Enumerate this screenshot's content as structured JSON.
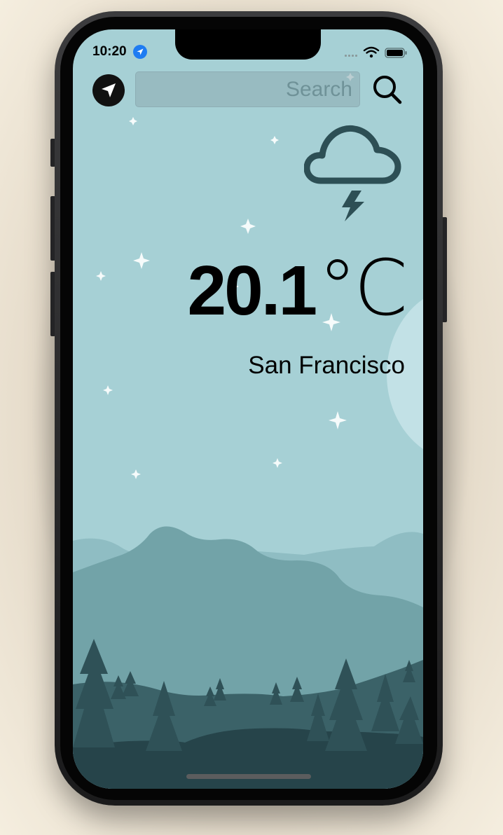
{
  "status_bar": {
    "time": "10:20",
    "location_icon": "location-arrow-icon",
    "signal_icon": "cellular-signal-icon",
    "wifi_icon": "wifi-icon",
    "battery_icon": "battery-icon"
  },
  "search": {
    "placeholder": "Search",
    "value": "",
    "current_location_icon": "navigation-arrow-icon",
    "search_icon": "magnifying-glass-icon"
  },
  "weather": {
    "temperature": "20.1",
    "unit": "°C",
    "condition_icon": "cloud-lightning-icon",
    "city": "San Francisco"
  },
  "colors": {
    "sky": "#a6d0d5",
    "moon": "#c2e1e6",
    "far_hills": "#8fbdc3",
    "mid_hills": "#72a3a8",
    "near_hills": "#3b6268",
    "foreground": "#26444a",
    "icon_stroke": "#2d4f55"
  }
}
